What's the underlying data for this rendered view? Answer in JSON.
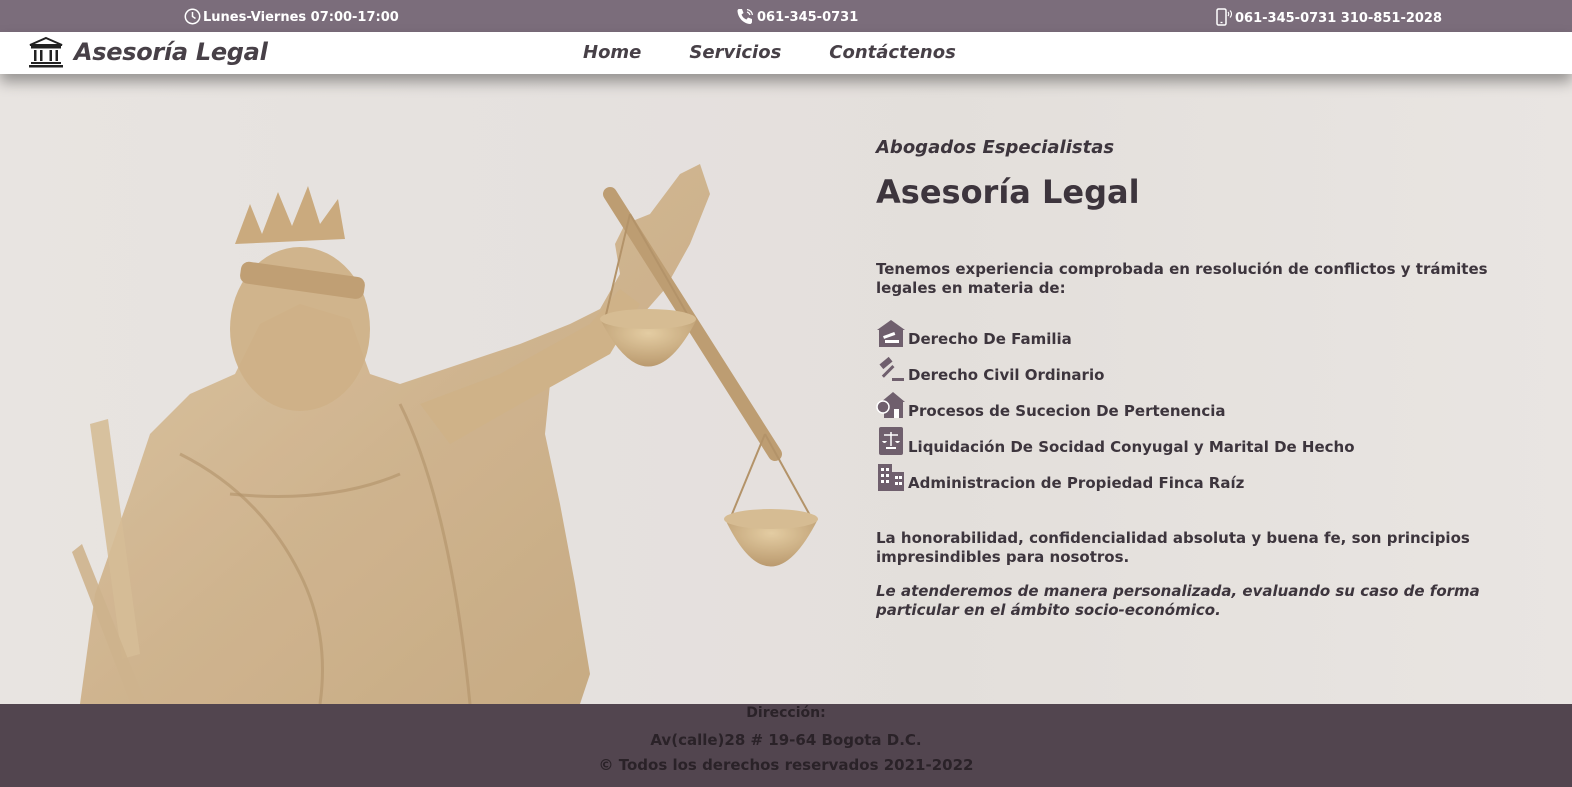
{
  "topbar": {
    "hours": "Lunes-Viernes 07:00-17:00",
    "phone": "061-345-0731",
    "mobile": "061-345-0731 310-851-2028",
    "icons": [
      "clock-icon",
      "phone-icon",
      "mobile-icon"
    ],
    "background": "#7b6d7b"
  },
  "navbar": {
    "brand": "Asesoría Legal",
    "brand_icon": "courthouse-icon",
    "links": [
      "Home",
      "Servicios",
      "Contáctenos"
    ]
  },
  "hero": {
    "subtitle": "Abogados Especialistas",
    "title": "Asesoría Legal",
    "intro": "Tenemos experiencia comprobada en resolución de conflictos y trámites legales en materia de:",
    "services": [
      {
        "label": "Derecho De Familia",
        "icon": "family-house-icon"
      },
      {
        "label": " Derecho Civil Ordinario",
        "icon": "gavel-icon"
      },
      {
        "label": "Procesos de Sucecion De Pertenencia",
        "icon": "property-house-icon"
      },
      {
        "label": "Liquidación De Socidad Conyugal y Marital De Hecho",
        "icon": "scales-book-icon"
      },
      {
        "label": "Administracion de Propiedad Finca Raíz",
        "icon": "building-icon"
      }
    ],
    "principles": "La honorabilidad, confidencialidad absoluta y buena fe, son principios impresindibles para nosotros.",
    "personal": "Le atenderemos de manera personalizada, evaluando su caso de forma particular en el ámbito socio-económico.",
    "image": "lady-justice-statue"
  },
  "footer": {
    "address_label": "Dirección:",
    "address": "Av(calle)28 # 19-64 Bogota D.C.",
    "copyright": "© Todos los derechos reservados 2021-2022",
    "background": "#52454f"
  }
}
